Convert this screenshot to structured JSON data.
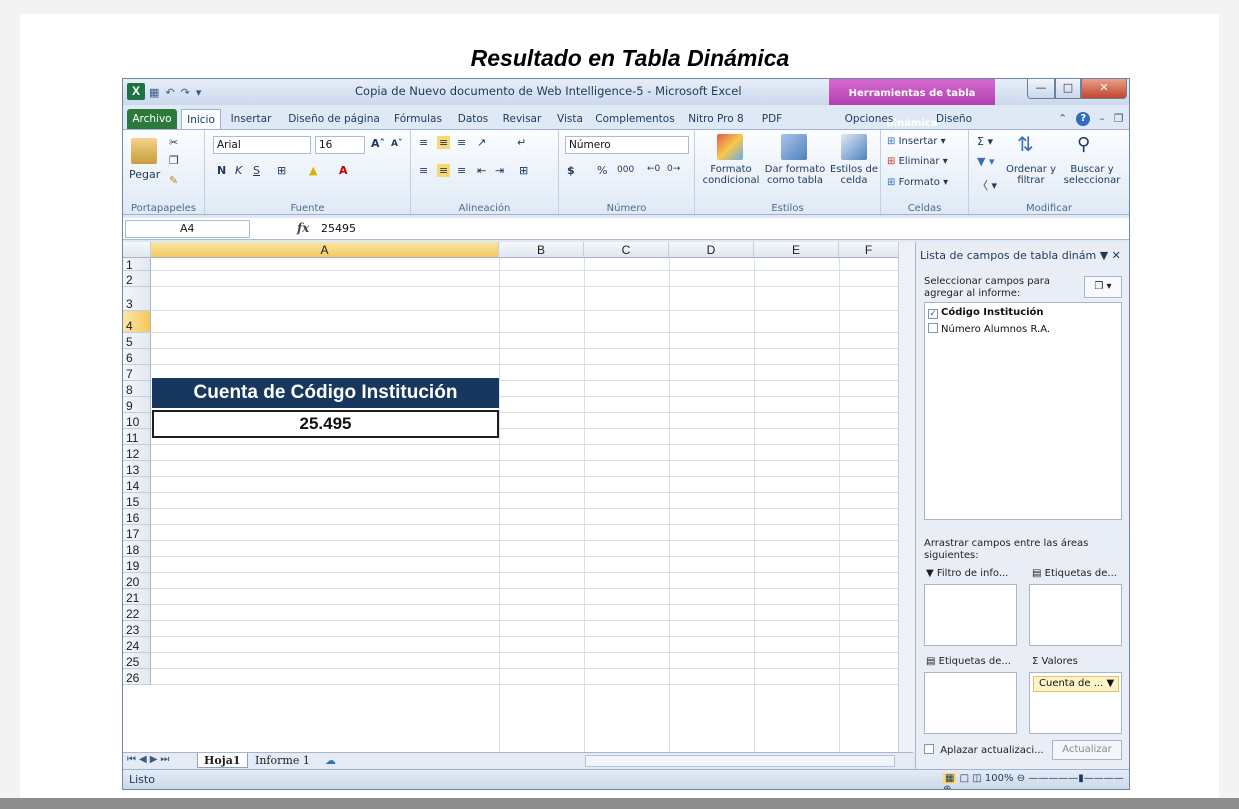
{
  "slide_title": "Resultado en Tabla Dinámica",
  "window": {
    "title": "Copia de Nuevo documento de Web Intelligence-5 - Microsoft Excel",
    "context_tab": "Herramientas de tabla dinámica"
  },
  "tabs": [
    "Archivo",
    "Inicio",
    "Insertar",
    "Diseño de página",
    "Fórmulas",
    "Datos",
    "Revisar",
    "Vista",
    "Complementos",
    "Nitro Pro 8",
    "PDF",
    "Opciones",
    "Diseño"
  ],
  "ribbon": {
    "portapapeles": {
      "label": "Portapapeles",
      "pegar": "Pegar"
    },
    "fuente": {
      "label": "Fuente",
      "font": "Arial",
      "size": "16",
      "bold": "N",
      "italic": "K",
      "underline": "S"
    },
    "alineacion": {
      "label": "Alineación"
    },
    "numero": {
      "label": "Número",
      "format": "Número",
      "currency": "$",
      "percent": "%",
      "thousands": "000"
    },
    "estilos": {
      "label": "Estilos",
      "formato_condicional": "Formato condicional",
      "dar_formato": "Dar formato como tabla",
      "estilos_celda": "Estilos de celda"
    },
    "celdas": {
      "label": "Celdas",
      "insertar": "Insertar",
      "eliminar": "Eliminar",
      "formato": "Formato"
    },
    "modificar": {
      "label": "Modificar",
      "ordenar": "Ordenar y filtrar",
      "buscar": "Buscar y seleccionar"
    }
  },
  "formula_bar": {
    "name_box": "A4",
    "fx": "fx",
    "value": "25495"
  },
  "grid": {
    "columns": [
      "A",
      "B",
      "C",
      "D",
      "E",
      "F"
    ],
    "rows": [
      "1",
      "2",
      "3",
      "4",
      "5",
      "6",
      "7",
      "8",
      "9",
      "10",
      "11",
      "12",
      "13",
      "14",
      "15",
      "16",
      "17",
      "18",
      "19",
      "20",
      "21",
      "22",
      "23",
      "24",
      "25",
      "26"
    ],
    "pivot_header": "Cuenta de Código Institución",
    "pivot_value": "25.495"
  },
  "sheets": {
    "active": "Hoja1",
    "other": "Informe 1"
  },
  "status": {
    "ready": "Listo",
    "zoom": "100%"
  },
  "pane": {
    "title": "Lista de campos de tabla dinám",
    "select_fields": "Seleccionar campos para agregar al informe:",
    "fields": [
      {
        "name": "Código Institución",
        "checked": true
      },
      {
        "name": "Número Alumnos R.A.",
        "checked": false
      }
    ],
    "drag_text": "Arrastrar campos entre las áreas siguientes:",
    "filter_area": "Filtro de info...",
    "column_area": "Etiquetas de...",
    "row_area": "Etiquetas de...",
    "values_area": "Valores",
    "values_chip": "Cuenta de ...",
    "defer_update": "Aplazar actualizaci...",
    "update_button": "Actualizar"
  }
}
